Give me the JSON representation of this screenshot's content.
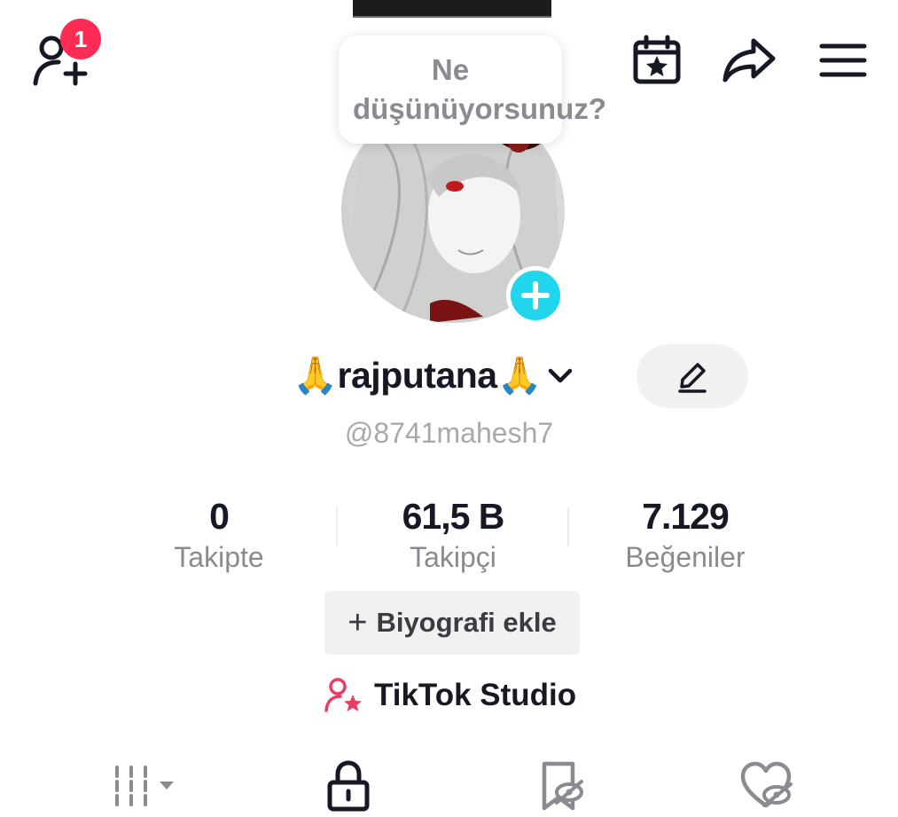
{
  "header": {
    "notification_badge": "1",
    "thought_bubble": "Ne düşünüyorsunuz?"
  },
  "profile": {
    "display_name": "🙏rajputana🙏",
    "username": "@8741mahesh7"
  },
  "stats": [
    {
      "value": "0",
      "label": "Takipte"
    },
    {
      "value": "61,5 B",
      "label": "Takipçi"
    },
    {
      "value": "7.129",
      "label": "Beğeniler"
    }
  ],
  "actions": {
    "add_bio_label": "Biyografi ekle",
    "add_bio_plus": "+",
    "studio_label": "TikTok Studio"
  },
  "tabs": {
    "items": [
      "videos-grid-icon",
      "lock-icon",
      "bookmark-icon",
      "liked-heart-icon"
    ],
    "active_index": 1
  },
  "colors": {
    "badge": "#fe2c55",
    "avatar_add": "#20d5ec",
    "studio_icon": "#e83e66",
    "primary_text": "#161823",
    "secondary_text": "#8a8b91"
  }
}
